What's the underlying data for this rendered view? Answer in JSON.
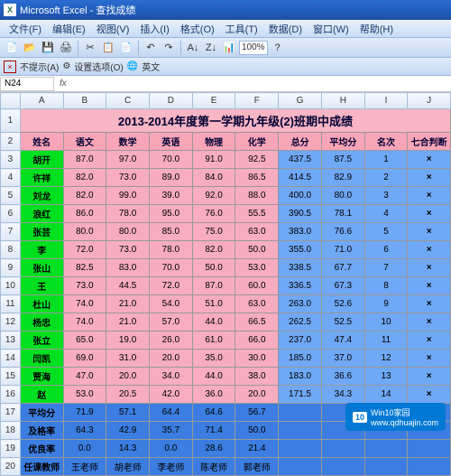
{
  "window": {
    "title": "Microsoft Excel - 查找成绩"
  },
  "menu": [
    "文件(F)",
    "编辑(E)",
    "视图(V)",
    "插入(I)",
    "格式(O)",
    "工具(T)",
    "数据(D)",
    "窗口(W)",
    "帮助(H)"
  ],
  "toolbar": {
    "zoom": "100%"
  },
  "taskbar": {
    "label1": "不提示(A)",
    "label2": "设置选项(O)",
    "label3": "英文"
  },
  "namebox": "N24",
  "columns": [
    "A",
    "B",
    "C",
    "D",
    "E",
    "F",
    "G",
    "H",
    "I",
    "J"
  ],
  "title": "2013-2014年度第一学期九年级(2)班期中成绩",
  "headers": [
    "姓名",
    "语文",
    "数学",
    "英语",
    "物理",
    "化学",
    "总分",
    "平均分",
    "名次",
    "七合判断"
  ],
  "chart_data": {
    "type": "table",
    "title": "2013-2014年度第一学期九年级(2)班期中成绩",
    "columns": [
      "姓名",
      "语文",
      "数学",
      "英语",
      "物理",
      "化学",
      "总分",
      "平均分",
      "名次",
      "七合判断"
    ],
    "rows": [
      {
        "姓名": "胡开",
        "语文": 87.0,
        "数学": 97.0,
        "英语": 70.0,
        "物理": 91.0,
        "化学": 92.5,
        "总分": 437.5,
        "平均分": 87.5,
        "名次": 1,
        "七合判断": "×"
      },
      {
        "姓名": "许祥",
        "语文": 82.0,
        "数学": 73.0,
        "英语": 89.0,
        "物理": 84.0,
        "化学": 86.5,
        "总分": 414.5,
        "平均分": 82.9,
        "名次": 2,
        "七合判断": "×"
      },
      {
        "姓名": "刘龙",
        "语文": 82.0,
        "数学": 99.0,
        "英语": 39.0,
        "物理": 92.0,
        "化学": 88.0,
        "总分": 400.0,
        "平均分": 80.0,
        "名次": 3,
        "七合判断": "×"
      },
      {
        "姓名": "浪红",
        "语文": 86.0,
        "数学": 78.0,
        "英语": 95.0,
        "物理": 76.0,
        "化学": 55.5,
        "总分": 390.5,
        "平均分": 78.1,
        "名次": 4,
        "七合判断": "×"
      },
      {
        "姓名": "张芸",
        "语文": 80.0,
        "数学": 80.0,
        "英语": 85.0,
        "物理": 75.0,
        "化学": 63.0,
        "总分": 383.0,
        "平均分": 76.6,
        "名次": 5,
        "七合判断": "×"
      },
      {
        "姓名": "李",
        "语文": 72.0,
        "数学": 73.0,
        "英语": 78.0,
        "物理": 82.0,
        "化学": 50.0,
        "总分": 355.0,
        "平均分": 71.0,
        "名次": 6,
        "七合判断": "×"
      },
      {
        "姓名": "张山",
        "语文": 82.5,
        "数学": 83.0,
        "英语": 70.0,
        "物理": 50.0,
        "化学": 53.0,
        "总分": 338.5,
        "平均分": 67.7,
        "名次": 7,
        "七合判断": "×"
      },
      {
        "姓名": "王",
        "语文": 73.0,
        "数学": 44.5,
        "英语": 72.0,
        "物理": 87.0,
        "化学": 60.0,
        "总分": 336.5,
        "平均分": 67.3,
        "名次": 8,
        "七合判断": "×"
      },
      {
        "姓名": "杜山",
        "语文": 74.0,
        "数学": 21.0,
        "英语": 54.0,
        "物理": 51.0,
        "化学": 63.0,
        "总分": 263.0,
        "平均分": 52.6,
        "名次": 9,
        "七合判断": "×"
      },
      {
        "姓名": "杨忠",
        "语文": 74.0,
        "数学": 21.0,
        "英语": 57.0,
        "物理": 44.0,
        "化学": 66.5,
        "总分": 262.5,
        "平均分": 52.5,
        "名次": 10,
        "七合判断": "×"
      },
      {
        "姓名": "张立",
        "语文": 65.0,
        "数学": 19.0,
        "英语": 26.0,
        "物理": 61.0,
        "化学": 66.0,
        "总分": 237.0,
        "平均分": 47.4,
        "名次": 11,
        "七合判断": "×"
      },
      {
        "姓名": "闫凯",
        "语文": 69.0,
        "数学": 31.0,
        "英语": 20.0,
        "物理": 35.0,
        "化学": 30.0,
        "总分": 185.0,
        "平均分": 37.0,
        "名次": 12,
        "七合判断": "×"
      },
      {
        "姓名": "贾海",
        "语文": 47.0,
        "数学": 20.0,
        "英语": 34.0,
        "物理": 44.0,
        "化学": 38.0,
        "总分": 183.0,
        "平均分": 36.6,
        "名次": 13,
        "七合判断": "×"
      },
      {
        "姓名": "赵",
        "语文": 53.0,
        "数学": 20.5,
        "英语": 42.0,
        "物理": 36.0,
        "化学": 20.0,
        "总分": 171.5,
        "平均分": 34.3,
        "名次": 14,
        "七合判断": "×"
      }
    ],
    "summary": [
      {
        "label": "平均分",
        "语文": 71.9,
        "数学": 57.1,
        "英语": 64.4,
        "物理": 64.6,
        "化学": 56.7
      },
      {
        "label": "及格率",
        "语文": 64.3,
        "数学": 42.9,
        "英语": 35.7,
        "物理": 71.4,
        "化学": 50.0
      },
      {
        "label": "优良率",
        "语文": 0.0,
        "数学": 14.3,
        "英语": 0.0,
        "物理": 28.6,
        "化学": 21.4
      },
      {
        "label": "任课教师",
        "语文": "王老师",
        "数学": "胡老师",
        "英语": "李老师",
        "物理": "陈老师",
        "化学": "郭老师"
      }
    ]
  },
  "watermark": {
    "brand": "10",
    "text": "Win10家园",
    "url": "www.qdhuajin.com"
  }
}
